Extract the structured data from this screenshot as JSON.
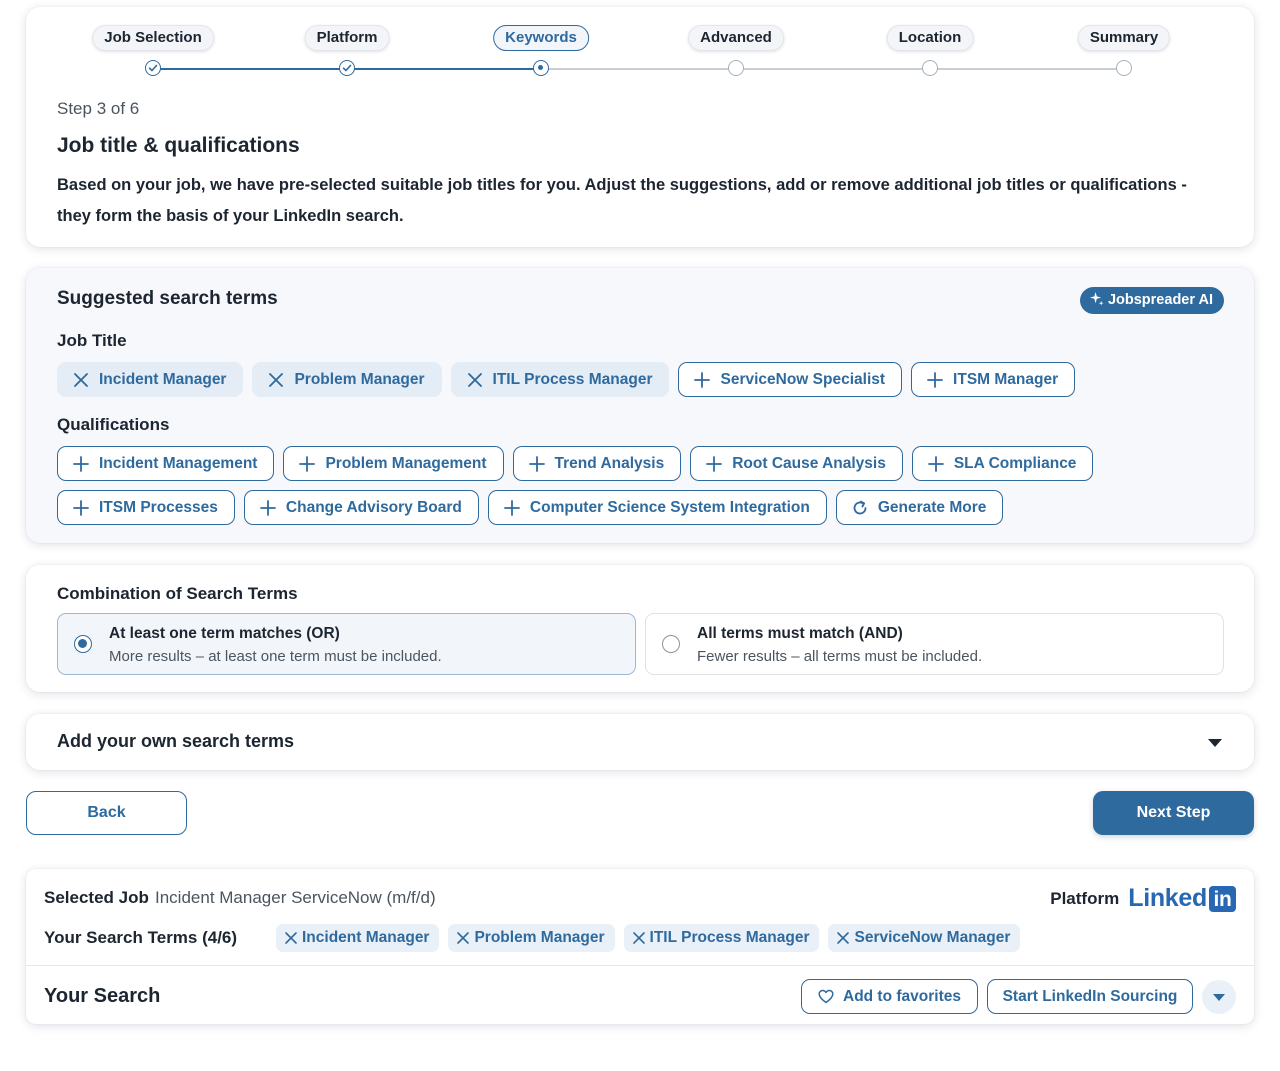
{
  "stepper": {
    "steps": [
      {
        "label": "Job Selection",
        "state": "done"
      },
      {
        "label": "Platform",
        "state": "done"
      },
      {
        "label": "Keywords",
        "state": "current"
      },
      {
        "label": "Advanced",
        "state": "todo"
      },
      {
        "label": "Location",
        "state": "todo"
      },
      {
        "label": "Summary",
        "state": "todo"
      }
    ],
    "counter": "Step 3 of 6"
  },
  "intro": {
    "title": "Job title & qualifications",
    "description": "Based on your job, we have pre-selected suitable job titles for you. Adjust the suggestions, add or remove additional job titles or qualifications - they form the basis of your LinkedIn search."
  },
  "suggested": {
    "title": "Suggested search terms",
    "ai_badge": "Jobspreader AI",
    "job_title_label": "Job Title",
    "job_titles": [
      {
        "label": "Incident Manager",
        "selected": true
      },
      {
        "label": "Problem Manager",
        "selected": true
      },
      {
        "label": "ITIL Process Manager",
        "selected": true
      },
      {
        "label": "ServiceNow Specialist",
        "selected": false
      },
      {
        "label": "ITSM Manager",
        "selected": false
      }
    ],
    "qualifications_label": "Qualifications",
    "qualifications_row1": [
      "Incident Management",
      "Problem Management",
      "Trend Analysis",
      "Root Cause Analysis",
      "SLA Compliance"
    ],
    "qualifications_row2": [
      "ITSM Processes",
      "Change Advisory Board",
      "Computer Science System Integration"
    ],
    "generate_more": "Generate More"
  },
  "combination": {
    "title": "Combination of Search Terms",
    "options": [
      {
        "title": "At least one term matches (OR)",
        "desc": "More results – at least one term must be included.",
        "checked": true
      },
      {
        "title": "All terms must match (AND)",
        "desc": "Fewer results – all terms must be included.",
        "checked": false
      }
    ]
  },
  "own_terms": {
    "title": "Add your own search terms"
  },
  "nav": {
    "back": "Back",
    "next": "Next Step"
  },
  "summary": {
    "selected_job_label": "Selected Job",
    "selected_job_value": "Incident Manager ServiceNow (m/f/d)",
    "platform_label": "Platform",
    "platform_logo_text": "Linked",
    "platform_logo_in": "in",
    "terms_label": "Your Search Terms (4/6)",
    "terms": [
      "Incident Manager",
      "Problem Manager",
      "ITIL Process Manager",
      "ServiceNow Manager"
    ],
    "your_search": "Your Search",
    "add_favorites": "Add to favorites",
    "start_sourcing": "Start LinkedIn Sourcing"
  },
  "colors": {
    "primary": "#2f6a9e",
    "chip_selected_bg": "#e4ecf6",
    "linkedin": "#2867b2"
  }
}
